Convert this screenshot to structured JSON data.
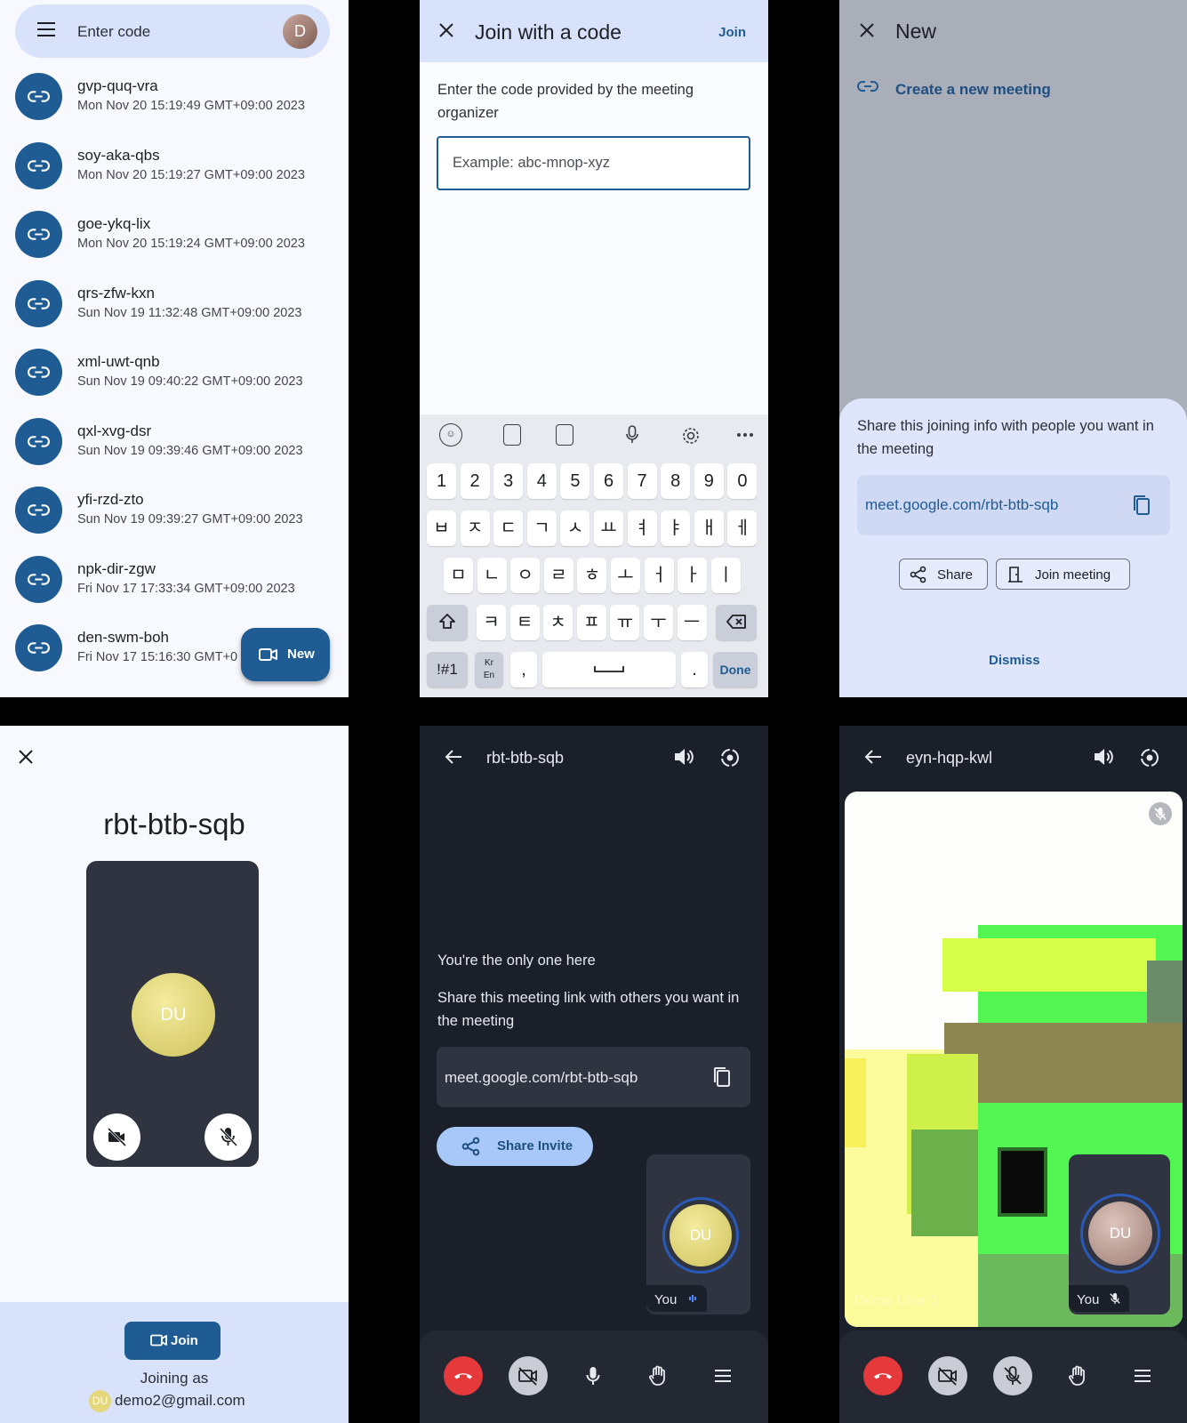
{
  "history": {
    "search_placeholder": "Enter code",
    "avatar_letter": "D",
    "items": [
      {
        "code": "gvp-quq-vra",
        "date": "Mon Nov 20 15:19:49 GMT+09:00 2023"
      },
      {
        "code": "soy-aka-qbs",
        "date": "Mon Nov 20 15:19:27 GMT+09:00 2023"
      },
      {
        "code": "goe-ykq-lix",
        "date": "Mon Nov 20 15:19:24 GMT+09:00 2023"
      },
      {
        "code": "qrs-zfw-kxn",
        "date": "Sun Nov 19 11:32:48 GMT+09:00 2023"
      },
      {
        "code": "xml-uwt-qnb",
        "date": "Sun Nov 19 09:40:22 GMT+09:00 2023"
      },
      {
        "code": "qxl-xvg-dsr",
        "date": "Sun Nov 19 09:39:46 GMT+09:00 2023"
      },
      {
        "code": "yfi-rzd-zto",
        "date": "Sun Nov 19 09:39:27 GMT+09:00 2023"
      },
      {
        "code": "npk-dir-zgw",
        "date": "Fri Nov 17 17:33:34 GMT+09:00 2023"
      },
      {
        "code": "den-swm-boh",
        "date": "Fri Nov 17 15:16:30 GMT+0"
      }
    ],
    "fab_label": "New"
  },
  "join_code": {
    "title": "Join with a code",
    "join_label": "Join",
    "description": "Enter the code provided by the meeting organizer",
    "input_placeholder": "Example: abc-mnop-xyz",
    "keyboard": {
      "numbers": [
        "1",
        "2",
        "3",
        "4",
        "5",
        "6",
        "7",
        "8",
        "9",
        "0"
      ],
      "row1": [
        "ㅂ",
        "ㅈ",
        "ㄷ",
        "ㄱ",
        "ㅅ",
        "ㅛ",
        "ㅕ",
        "ㅑ",
        "ㅐ",
        "ㅔ"
      ],
      "row2": [
        "ㅁ",
        "ㄴ",
        "ㅇ",
        "ㄹ",
        "ㅎ",
        "ㅗ",
        "ㅓ",
        "ㅏ",
        "ㅣ"
      ],
      "row3": [
        "ㅋ",
        "ㅌ",
        "ㅊ",
        "ㅍ",
        "ㅠ",
        "ㅜ",
        "ㅡ"
      ],
      "symbols": "!#1",
      "lang_top": "Kr",
      "lang_bottom": "En",
      "comma": ",",
      "period": ".",
      "done": "Done"
    }
  },
  "new_meeting": {
    "title": "New",
    "create_label": "Create a new meeting",
    "sheet_message": "Share this joining info with people you want in the meeting",
    "link": "meet.google.com/rbt-btb-sqb",
    "share_label": "Share",
    "join_meeting_label": "Join meeting",
    "dismiss_label": "Dismiss"
  },
  "prejoin": {
    "code": "rbt-btb-sqb",
    "avatar_initials": "DU",
    "join_label": "Join",
    "joining_as": "Joining as",
    "account_initials": "DU",
    "account": "demo2@gmail.com"
  },
  "lobby": {
    "code": "rbt-btb-sqb",
    "only_one": "You're the only one here",
    "share_message": "Share this meeting link with others you want in the meeting",
    "link": "meet.google.com/rbt-btb-sqb",
    "share_invite_label": "Share Invite",
    "self_initials": "DU",
    "you_label": "You"
  },
  "call": {
    "code": "eyn-hqp-kwl",
    "remote_name": "Demo User 3",
    "self_initials": "DU",
    "you_label": "You"
  },
  "colors": {
    "primary": "#1f5c94",
    "container": "#d9e2fb",
    "dark_bg": "#1a1f29",
    "end_call": "#e5393b"
  }
}
